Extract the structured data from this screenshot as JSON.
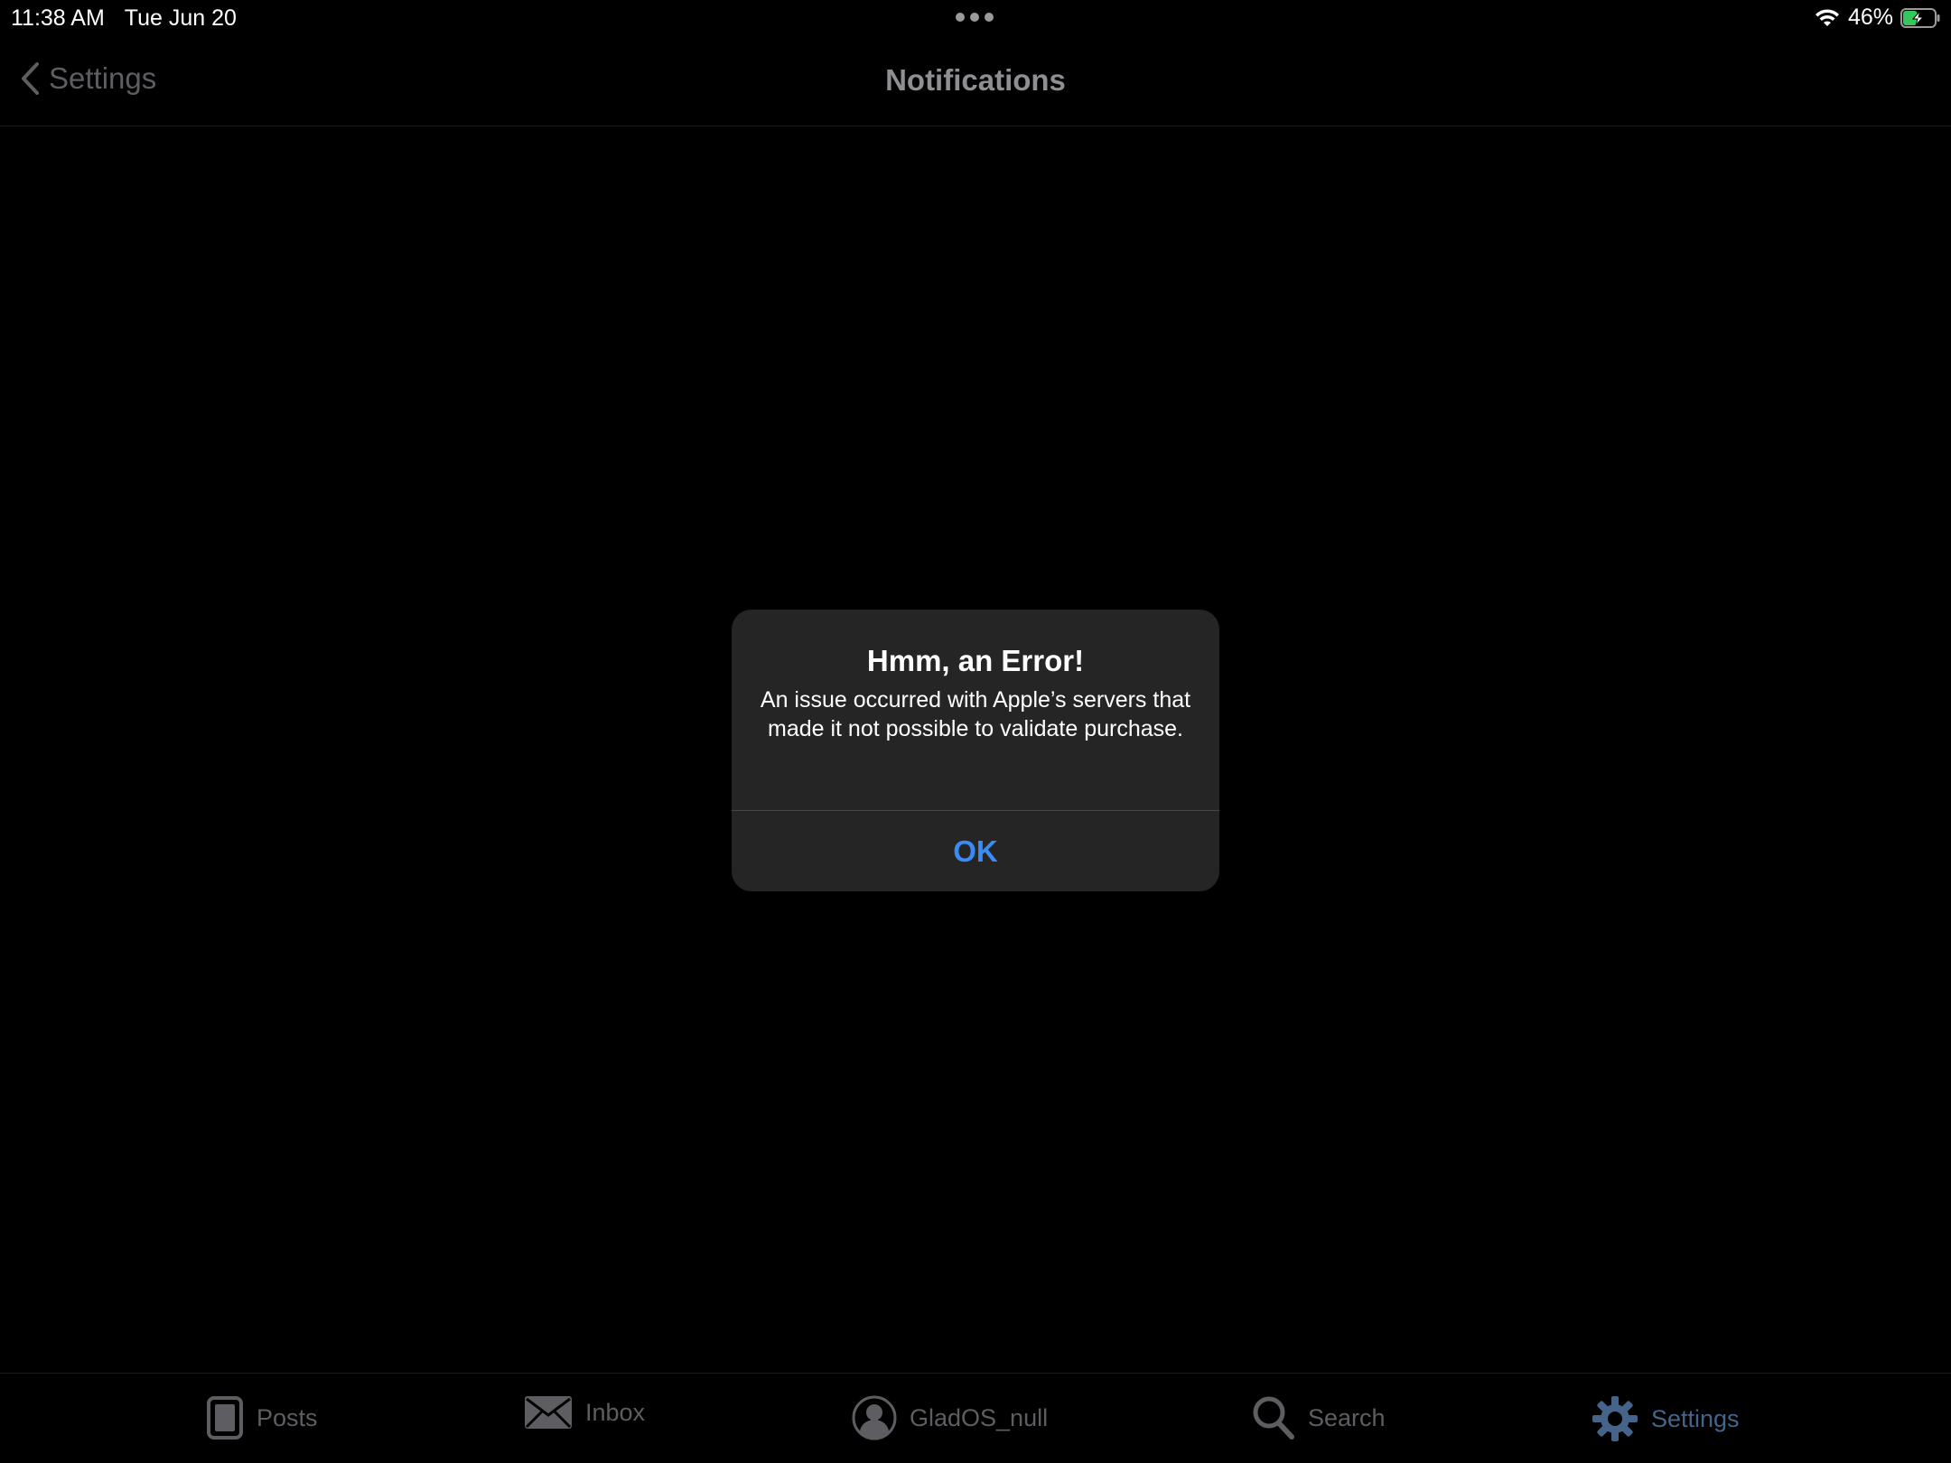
{
  "status_bar": {
    "time": "11:38 AM",
    "date": "Tue Jun 20",
    "battery_percent": "46%",
    "battery_level": 46,
    "charging": true
  },
  "nav": {
    "back_label": "Settings",
    "title": "Notifications"
  },
  "alert": {
    "title": "Hmm, an Error!",
    "message": "An issue occurred with Apple’s servers that made it not possible to validate purchase.",
    "ok_label": "OK"
  },
  "tabs": [
    {
      "label": "Posts",
      "icon": "posts-icon",
      "active": false
    },
    {
      "label": "Inbox",
      "icon": "envelope-icon",
      "active": false
    },
    {
      "label": "GladOS_null",
      "icon": "user-avatar-icon",
      "active": false
    },
    {
      "label": "Search",
      "icon": "magnifier-icon",
      "active": false
    },
    {
      "label": "Settings",
      "icon": "gear-icon",
      "active": true
    }
  ],
  "colors": {
    "accent": "#3a8cf4",
    "active_tab": "#46648a",
    "inactive": "#5e5e62",
    "battery_green": "#35c759"
  }
}
